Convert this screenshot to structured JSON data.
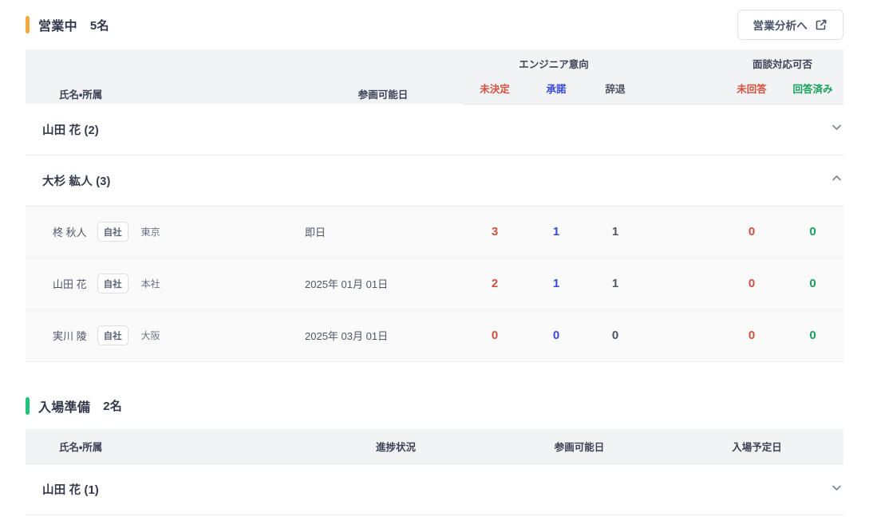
{
  "sections": [
    {
      "id": "eigyochu",
      "accent_color": "#f5a83c",
      "title": "営業中",
      "count": "5名",
      "action_button": {
        "label": "営業分析へ",
        "icon": "external-link-icon"
      },
      "columns": {
        "name": "氏名・所属",
        "available_date": "参画可能日",
        "group_intent": "エンジニア意向",
        "group_interview": "面談対応可否",
        "intent_undecided": "未決定",
        "intent_accepted": "承諾",
        "intent_declined": "辞退",
        "interview_unanswered": "未回答",
        "interview_answered": "回答済み"
      },
      "groups": [
        {
          "label": "山田 花 (2)",
          "expanded": false,
          "chevron": "chevron-down-icon",
          "rows": []
        },
        {
          "label": "大杉 紘人 (3)",
          "expanded": true,
          "chevron": "chevron-up-icon",
          "rows": [
            {
              "name": "柊 秋人",
              "badge": "自社",
              "dept": "東京",
              "available_date": "即日",
              "undecided": "3",
              "accepted": "1",
              "declined": "1",
              "unanswered": "0",
              "answered": "0"
            },
            {
              "name": "山田 花",
              "badge": "自社",
              "dept": "本社",
              "available_date": "2025年 01月 01日",
              "undecided": "2",
              "accepted": "1",
              "declined": "1",
              "unanswered": "0",
              "answered": "0"
            },
            {
              "name": "実川 陵",
              "badge": "自社",
              "dept": "大阪",
              "available_date": "2025年 03月 01日",
              "undecided": "0",
              "accepted": "0",
              "declined": "0",
              "unanswered": "0",
              "answered": "0"
            }
          ]
        }
      ]
    },
    {
      "id": "nyujo-junbi",
      "accent_color": "#1ec47a",
      "title": "入場準備",
      "count": "2名",
      "columns": {
        "name": "氏名・所属",
        "progress": "進捗状況",
        "available_date": "参画可能日",
        "entry_date": "入場予定日"
      },
      "groups": [
        {
          "label": "山田 花 (1)",
          "expanded": false,
          "chevron": "chevron-down-icon",
          "rows": []
        }
      ]
    }
  ]
}
